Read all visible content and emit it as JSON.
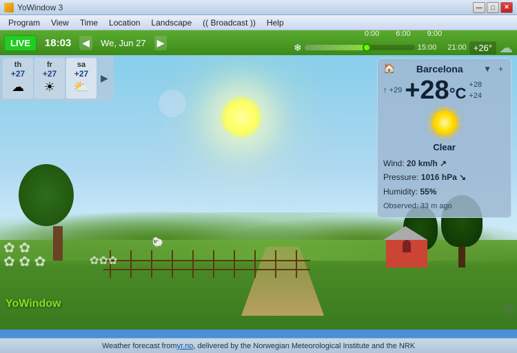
{
  "window": {
    "title": "YoWindow 3",
    "min_btn": "—",
    "max_btn": "□",
    "close_btn": "✕"
  },
  "menu": {
    "items": [
      "Program",
      "View",
      "Time",
      "Location",
      "Landscape",
      "(( Broadcast ))",
      "Help"
    ]
  },
  "toolbar": {
    "live_label": "LIVE",
    "time": "18:03",
    "nav_prev": "◀",
    "nav_next": "▶",
    "date": "We, Jun 27",
    "timeline_labels": [
      "0:00",
      "6:00",
      "9:00",
      "15:00",
      "21:00"
    ],
    "temp_badge": "+26°",
    "progress_pct": 55
  },
  "forecast": {
    "days": [
      {
        "name": "th",
        "temp": "+27",
        "icon": "☁"
      },
      {
        "name": "fr",
        "temp": "+27",
        "icon": "☀"
      },
      {
        "name": "sa",
        "temp": "+27",
        "icon": "⛅"
      }
    ]
  },
  "weather": {
    "city": "Barcelona",
    "temp_high": "+28",
    "temp_unit": "°C",
    "temp_side_high": "+28",
    "temp_side_low": "+24",
    "temp_arrow": "↑",
    "temp_left": "+29",
    "condition": "Clear",
    "wind_label": "Wind:",
    "wind_value": "20 km/h ↗",
    "pressure_label": "Pressure:",
    "pressure_value": "1016 hPa ↘",
    "humidity_label": "Humidity:",
    "humidity_value": "55%",
    "observed_label": "Observed:",
    "observed_value": "33 m ago"
  },
  "status_bar": {
    "text_before": "Weather forecast from ",
    "link_text": "yr.no",
    "text_after": ", delivered by the Norwegian Meteorological Institute and the NRK"
  },
  "logo": {
    "part1": "Yo",
    "part2": "Window"
  }
}
